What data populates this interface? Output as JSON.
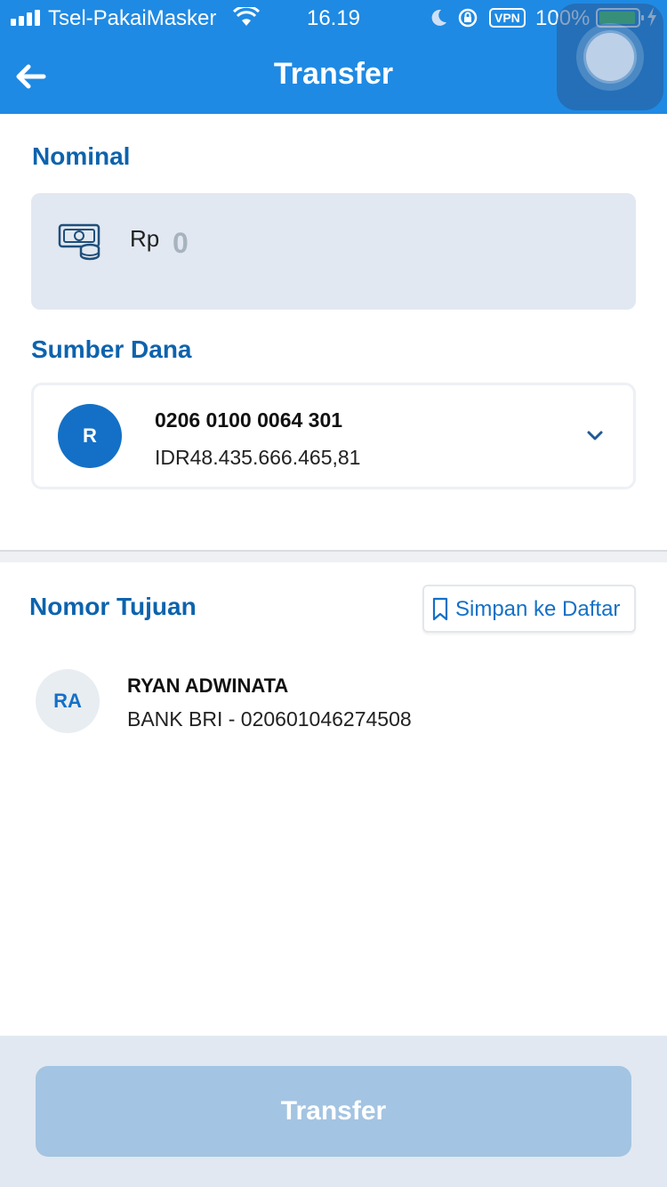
{
  "status_bar": {
    "carrier": "Tsel-PakaiMasker",
    "time": "16.19",
    "vpn": "VPN",
    "battery_pct": "100%"
  },
  "header": {
    "title": "Transfer"
  },
  "nominal": {
    "label": "Nominal",
    "currency": "Rp",
    "amount": "0"
  },
  "source": {
    "label": "Sumber Dana",
    "avatar_initial": "R",
    "account_number": "0206 0100 0064 301",
    "balance": "IDR48.435.666.465,81"
  },
  "destination": {
    "label": "Nomor Tujuan",
    "save_label": "Simpan ke Daftar",
    "recipient": {
      "initials": "RA",
      "name": "RYAN ADWINATA",
      "bank": "BANK BRI - 020601046274508"
    }
  },
  "footer": {
    "button_label": "Transfer"
  },
  "colors": {
    "primary": "#1f8ae3",
    "label_blue": "#0d63ad",
    "disabled_button": "#a3c4e2",
    "input_bg": "#e1e8f1"
  },
  "icons": [
    "signal-icon",
    "wifi-icon",
    "moon-icon",
    "rotation-lock-icon",
    "battery-icon",
    "charging-bolt-icon",
    "back-arrow-icon",
    "money-icon",
    "chevron-down-icon",
    "bookmark-icon",
    "assistive-touch-icon"
  ]
}
